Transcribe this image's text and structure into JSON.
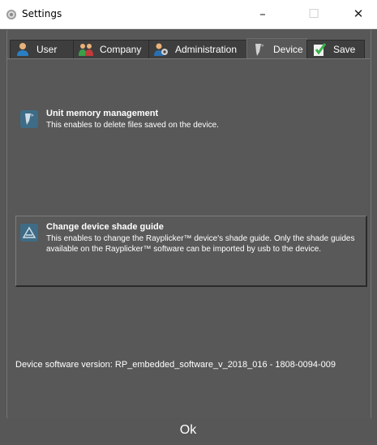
{
  "window": {
    "title": "Settings",
    "minimize_label": "–",
    "maximize_label": "☐",
    "close_label": "✕"
  },
  "tabs": [
    {
      "label": "User",
      "icon": "user-icon"
    },
    {
      "label": "Company",
      "icon": "company-icon"
    },
    {
      "label": "Administration",
      "icon": "administration-icon"
    },
    {
      "label": "Device",
      "icon": "device-icon",
      "active": true
    },
    {
      "label": "Save",
      "icon": "save-icon"
    }
  ],
  "device": {
    "memory": {
      "title": "Unit memory management",
      "description": "This enables to delete files saved on the device."
    },
    "shade_guide": {
      "title": "Change device shade guide",
      "description": "This enables to change the Rayplicker™ device's shade guide. Only the shade guides available on the Rayplicker™ software can be imported by usb to the device."
    },
    "version_text": "Device software version: RP_embedded_software_v_2018_016 - 1808-0094-009"
  },
  "footer": {
    "ok_label": "Ok"
  },
  "colors": {
    "background": "#575757",
    "tab_bg": "#3e3e3e",
    "icon_accent": "#3e6c86"
  }
}
